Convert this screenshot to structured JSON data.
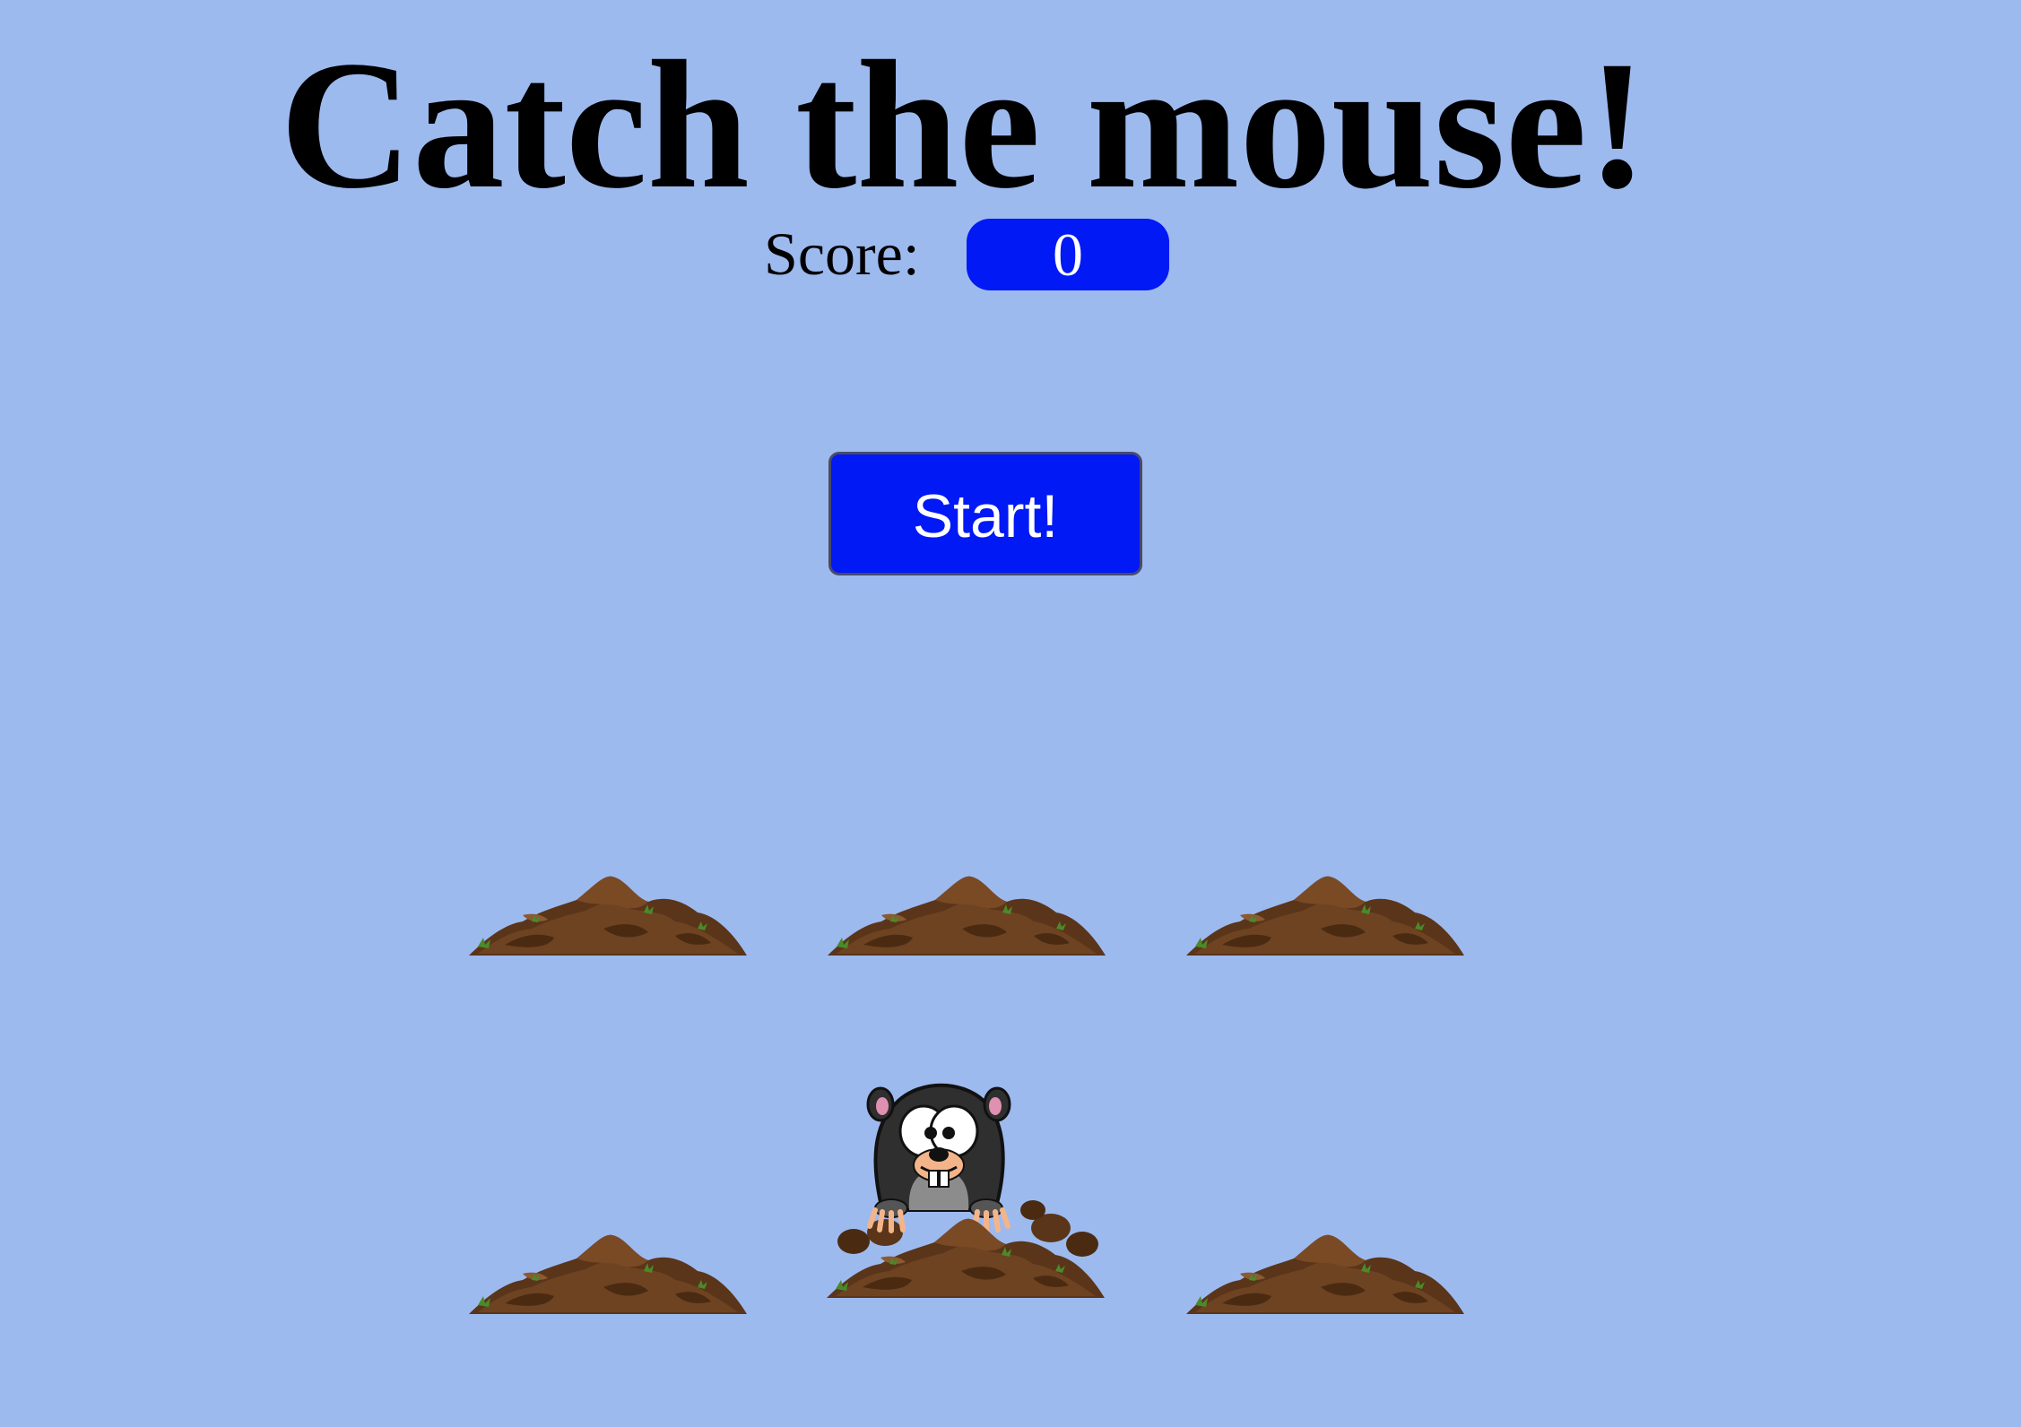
{
  "game": {
    "title": "Catch the mouse!",
    "score_label": "Score:",
    "score_value": "0",
    "start_label": "Start!"
  },
  "board": {
    "holes": [
      {
        "row": 1,
        "col": 1,
        "occupied": false
      },
      {
        "row": 1,
        "col": 2,
        "occupied": false
      },
      {
        "row": 1,
        "col": 3,
        "occupied": false
      },
      {
        "row": 2,
        "col": 1,
        "occupied": false
      },
      {
        "row": 2,
        "col": 2,
        "occupied": true
      },
      {
        "row": 2,
        "col": 3,
        "occupied": false
      }
    ]
  },
  "colors": {
    "background": "#9dbaef",
    "accent_blue": "#0019f5",
    "dirt": "#5a3519"
  }
}
